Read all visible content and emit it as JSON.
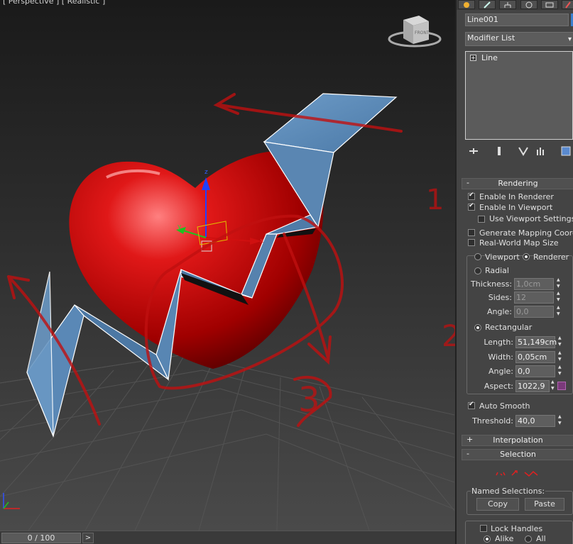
{
  "viewport": {
    "label": "[ Perspective ] [ Realistic ]",
    "viewcube_label": "FRONT",
    "annotations": [
      "1",
      "2",
      "3"
    ],
    "axis_labels": {
      "x": "x",
      "y": "y",
      "z": "z"
    }
  },
  "timeline": {
    "value": "0 / 100",
    "next_label": ">"
  },
  "panel": {
    "object_name": "Line001",
    "object_color": "#3a7fd0",
    "modifier_list": "Modifier List",
    "stack": [
      {
        "label": "Line"
      }
    ],
    "rendering": {
      "title": "Rendering",
      "collapse_sign": "-",
      "enable_in_renderer": "Enable In Renderer",
      "enable_in_viewport": "Enable In Viewport",
      "use_viewport_settings": "Use Viewport Settings",
      "generate_mapping": "Generate Mapping Coords.",
      "real_world_map": "Real-World Map Size",
      "viewport_radio": "Viewport",
      "renderer_radio": "Renderer",
      "radial": "Radial",
      "thickness_label": "Thickness:",
      "thickness_value": "1,0cm",
      "sides_label": "Sides:",
      "sides_value": "12",
      "angle_label": "Angle:",
      "angle_value": "0,0",
      "rectangular": "Rectangular",
      "length_label": "Length:",
      "length_value": "51,149cm",
      "width_label": "Width:",
      "width_value": "0,05cm",
      "rect_angle_label": "Angle:",
      "rect_angle_value": "0,0",
      "aspect_label": "Aspect:",
      "aspect_value": "1022,9",
      "auto_smooth": "Auto Smooth",
      "threshold_label": "Threshold:",
      "threshold_value": "40,0"
    },
    "interpolation": {
      "title": "Interpolation",
      "sign": "+"
    },
    "selection": {
      "title": "Selection",
      "sign": "-",
      "named_selections": "Named Selections:",
      "copy": "Copy",
      "paste": "Paste",
      "lock_handles": "Lock Handles",
      "alike": "Alike",
      "all": "All"
    }
  }
}
